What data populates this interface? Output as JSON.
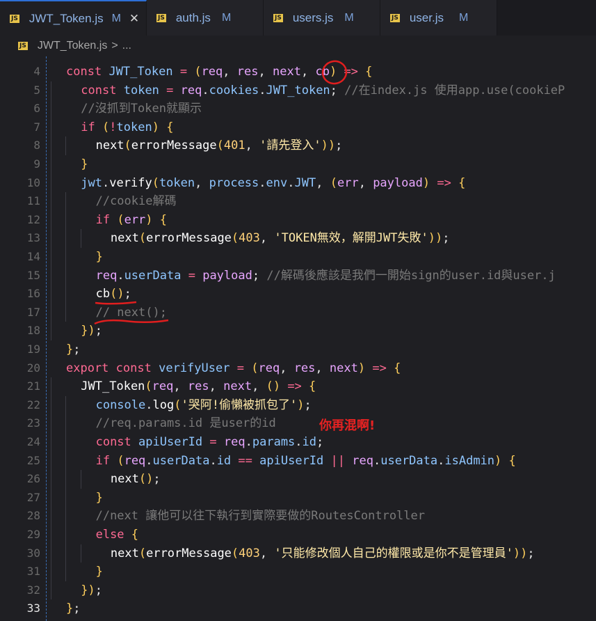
{
  "tabs": [
    {
      "icon": "JS",
      "name": "JWT_Token.js",
      "status": "M",
      "close": "✕",
      "active": true
    },
    {
      "icon": "JS",
      "name": "auth.js",
      "status": "M"
    },
    {
      "icon": "JS",
      "name": "users.js",
      "status": "M"
    },
    {
      "icon": "JS",
      "name": "user.js",
      "status": "M"
    }
  ],
  "breadcrumb": {
    "icon": "JS",
    "file": "JWT_Token.js",
    "separator": ">",
    "more": "..."
  },
  "annotation": "你再混啊!",
  "lines": [
    {
      "n": "4",
      "code": "const JWT_Token = (req, res, next, cb) => {"
    },
    {
      "n": "5",
      "code": "const token = req.cookies.JWT_token; //在index.js 使用app.use(cookieP"
    },
    {
      "n": "6",
      "code": "//沒抓到Token就顯示"
    },
    {
      "n": "7",
      "code": "if (!token) {"
    },
    {
      "n": "8",
      "code": "next(errorMessage(401, '請先登入'));"
    },
    {
      "n": "9",
      "code": "}"
    },
    {
      "n": "10",
      "code": "jwt.verify(token, process.env.JWT, (err, payload) => {"
    },
    {
      "n": "11",
      "code": "//cookie解碼"
    },
    {
      "n": "12",
      "code": "if (err) {"
    },
    {
      "n": "13",
      "code": "next(errorMessage(403, 'TOKEN無效，解開JWT失敗'));"
    },
    {
      "n": "14",
      "code": "}"
    },
    {
      "n": "15",
      "code": "req.userData = payload; //解碼後應該是我們一開始sign的user.id與user.j"
    },
    {
      "n": "16",
      "code": "cb();"
    },
    {
      "n": "17",
      "code": "// next();"
    },
    {
      "n": "18",
      "code": "});"
    },
    {
      "n": "19",
      "code": "};"
    },
    {
      "n": "20",
      "code": "export const verifyUser = (req, res, next) => {"
    },
    {
      "n": "21",
      "code": "JWT_Token(req, res, next, () => {"
    },
    {
      "n": "22",
      "code": "console.log('哭阿!偷懶被抓包了');"
    },
    {
      "n": "23",
      "code": "//req.params.id 是user的id"
    },
    {
      "n": "24",
      "code": "const apiUserId = req.params.id;"
    },
    {
      "n": "25",
      "code": "if (req.userData.id == apiUserId || req.userData.isAdmin) {"
    },
    {
      "n": "26",
      "code": "next();"
    },
    {
      "n": "27",
      "code": "}"
    },
    {
      "n": "28",
      "code": "//next 讓他可以往下執行到實際要做的RoutesController"
    },
    {
      "n": "29",
      "code": "else {"
    },
    {
      "n": "30",
      "code": "next(errorMessage(403, '只能修改個人自己的權限或是你不是管理員'));"
    },
    {
      "n": "31",
      "code": "}"
    },
    {
      "n": "32",
      "code": "});"
    },
    {
      "n": "33",
      "code": "};"
    }
  ]
}
